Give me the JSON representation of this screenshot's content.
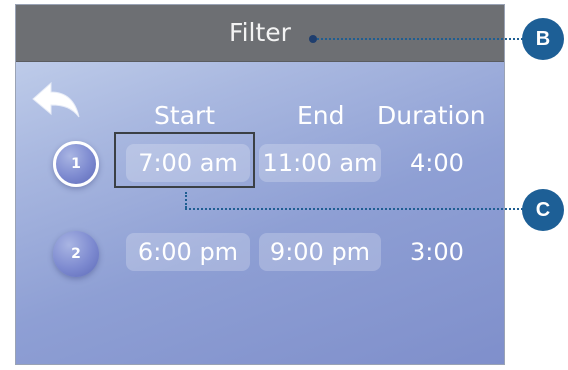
{
  "header": {
    "title": "Filter"
  },
  "columns": {
    "start": "Start",
    "end": "End",
    "duration": "Duration"
  },
  "rows": [
    {
      "number": "1",
      "start": "7:00 am",
      "end": "11:00 am",
      "duration": "4:00"
    },
    {
      "number": "2",
      "start": "6:00 pm",
      "end": "9:00 pm",
      "duration": "3:00"
    }
  ],
  "callouts": {
    "b": "B",
    "c": "C"
  },
  "icons": {
    "back": "back-arrow-icon"
  },
  "colors": {
    "title_bar": "#6d6f73",
    "callout": "#1d5f96"
  }
}
